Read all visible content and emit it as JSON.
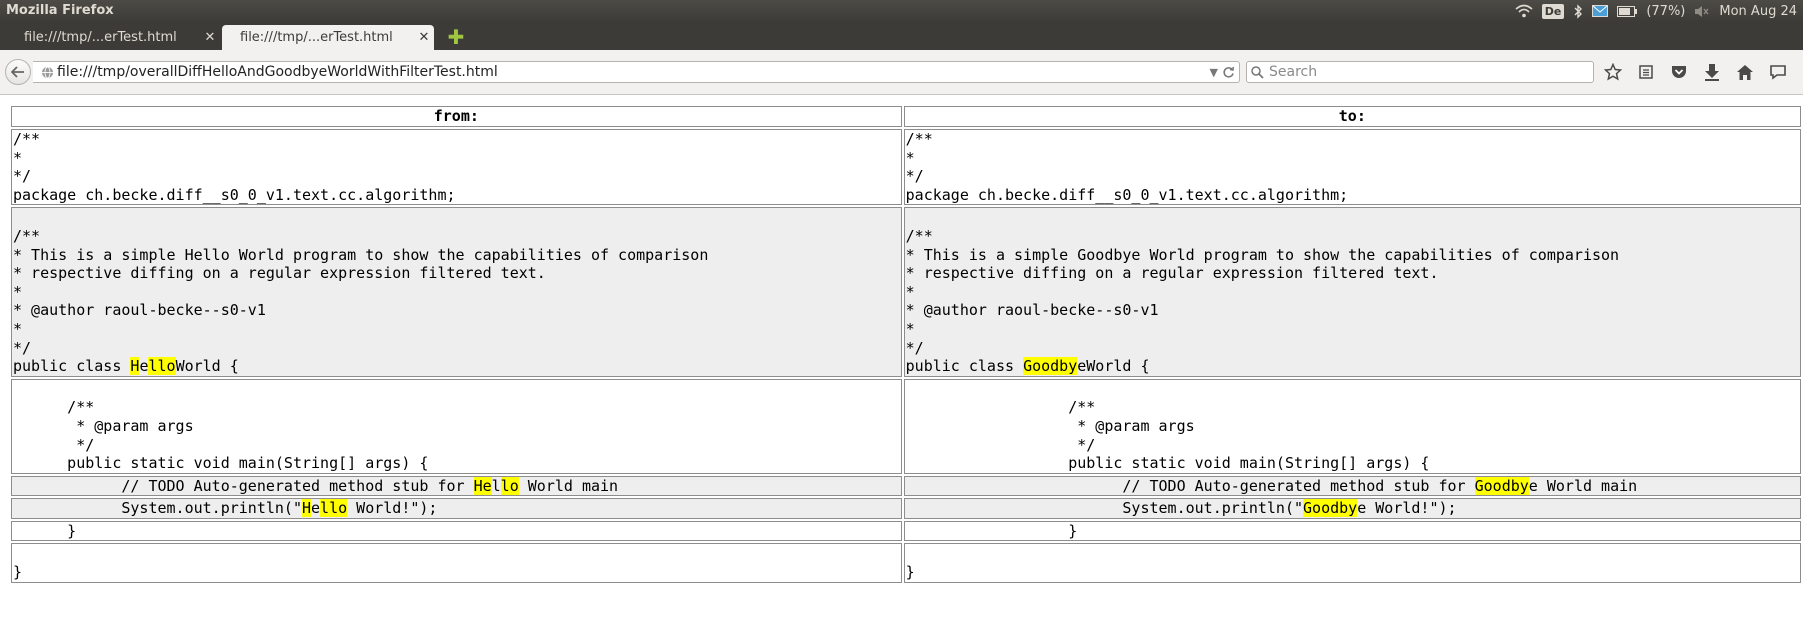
{
  "system": {
    "window_title": "Mozilla Firefox",
    "keyboard_layout": "De",
    "battery": "(77%)",
    "clock": "Mon Aug 24",
    "icons": [
      "wifi-icon",
      "bluetooth-icon",
      "mail-icon",
      "battery-icon",
      "volume-muted-icon"
    ]
  },
  "tabs": [
    {
      "label": "file:///tmp/...erTest.html",
      "active": false
    },
    {
      "label": "file:///tmp/...erTest.html",
      "active": true
    }
  ],
  "navbar": {
    "url": "file:///tmp/overallDiffHelloAndGoodbyeWorldWithFilterTest.html",
    "search_placeholder": "Search",
    "toolbar_icons": [
      "bookmark-star-icon",
      "reading-list-icon",
      "pocket-icon",
      "download-icon",
      "home-icon",
      "chat-icon"
    ]
  },
  "diff": {
    "from_header": "from:",
    "to_header": "to:",
    "rows": [
      {
        "state": "same",
        "from": [
          [
            "/**\n*\n*/\npackage ch.becke.diff__s0_0_v1.text.cc.algorithm;",
            false
          ]
        ],
        "to": [
          [
            "/**\n*\n*/\npackage ch.becke.diff__s0_0_v1.text.cc.algorithm;",
            false
          ]
        ]
      },
      {
        "state": "changed",
        "from": [
          [
            "\n/**\n* This is a simple Hello World program to show the capabilities of comparison\n* respective diffing on a regular expression filtered text.\n*\n* @author raoul-becke--s0-v1\n*\n*/\npublic class ",
            false
          ],
          [
            "H",
            true
          ],
          [
            "e",
            false
          ],
          [
            "llo",
            true
          ],
          [
            "World {",
            false
          ]
        ],
        "to": [
          [
            "\n/**\n* This is a simple Goodbye World program to show the capabilities of comparison\n* respective diffing on a regular expression filtered text.\n*\n* @author raoul-becke--s0-v1\n*\n*/\npublic class ",
            false
          ],
          [
            "Goodby",
            true
          ],
          [
            "e",
            false
          ],
          [
            "World {",
            false
          ]
        ]
      },
      {
        "state": "same",
        "from": [
          [
            "\n      /**\n       * @param args\n       */\n      public static void main(String[] args) {",
            false
          ]
        ],
        "to": [
          [
            "\n                  /**\n                   * @param args\n                   */\n                  public static void main(String[] args) {",
            false
          ]
        ]
      },
      {
        "state": "changed",
        "from": [
          [
            "            // TODO Auto-generated method stub for ",
            false
          ],
          [
            "He",
            true
          ],
          [
            "l",
            false
          ],
          [
            "lo",
            true
          ],
          [
            " World main",
            false
          ]
        ],
        "to": [
          [
            "                        // TODO Auto-generated method stub for ",
            false
          ],
          [
            "Goodby",
            true
          ],
          [
            "e World main",
            false
          ]
        ]
      },
      {
        "state": "changed",
        "from": [
          [
            "            System.out.println(\"",
            false
          ],
          [
            "H",
            true
          ],
          [
            "e",
            false
          ],
          [
            "llo",
            true
          ],
          [
            " World!\");",
            false
          ]
        ],
        "to": [
          [
            "                        System.out.println(\"",
            false
          ],
          [
            "Goodby",
            true
          ],
          [
            "e World!\");",
            false
          ]
        ]
      },
      {
        "state": "same",
        "from": [
          [
            "      }",
            false
          ]
        ],
        "to": [
          [
            "                  }",
            false
          ]
        ]
      },
      {
        "state": "same",
        "from": [
          [
            "\n}",
            false
          ]
        ],
        "to": [
          [
            "\n}",
            false
          ]
        ]
      }
    ]
  }
}
